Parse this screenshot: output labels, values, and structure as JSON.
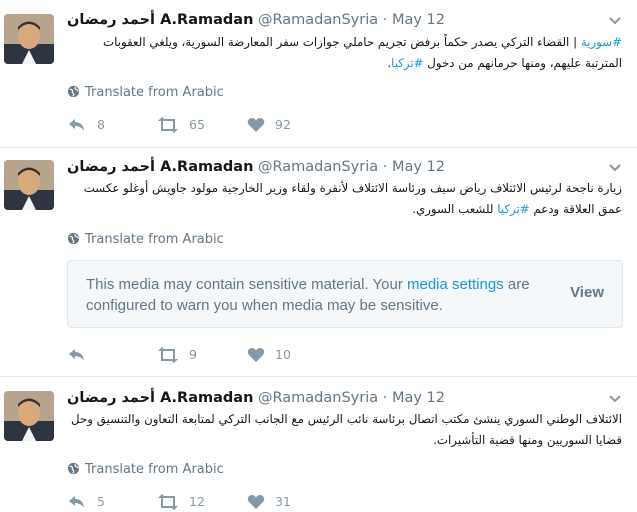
{
  "tweets": [
    {
      "name_ar": "أحمد رمضان",
      "name": "A.Ramadan",
      "handle": "@RamadanSyria",
      "dot": "·",
      "date": "May 12",
      "body_hashtag_a": "#سورية",
      "body_sep": " | ",
      "body_text": "القضاء التركي يصدر حكماً برفض تجريم حاملي جوازات سفر المعارضة السورية، ويلغي العقوبات المترتبة عليهم، ومنها حرمانهم من دخول ",
      "body_hashtag_b": "#تركيا",
      "body_end": ".",
      "translate": "Translate from Arabic",
      "retweets": "65",
      "replies": "8",
      "likes": "92"
    },
    {
      "name_ar": "أحمد رمضان",
      "name": "A.Ramadan",
      "handle": "@RamadanSyria",
      "dot": "·",
      "date": "May 12",
      "body_text": "زيارة ناجحة لرئيس الائتلاف رياض سيف ورئاسة الائتلاف لأنقرة ولقاء وزير الخارجية مولود جاويش أوغلو عكست عمق العلاقة ودعم ",
      "body_hashtag": "#تركيا",
      "body_end": " للشعب السوري.",
      "translate": "Translate from Arabic",
      "media_text_1": "This media may contain sensitive material. Your ",
      "media_link": "media settings",
      "media_text_2": " are configured to warn you when media may be sensitive.",
      "media_view": "View",
      "replies": "",
      "retweets": "9",
      "likes": "10"
    },
    {
      "name_ar": "أحمد رمضان",
      "name": "A.Ramadan",
      "handle": "@RamadanSyria",
      "dot": "·",
      "date": "May 12",
      "body_text": "الائتلاف الوطني السوري ينشئ مكتب اتصال برئاسة نائب الرئيس مع الجانب التركي لمتابعة التعاون والتنسيق وحل قضايا السوريين ومنها قضية التأشيرات.",
      "translate": "Translate from Arabic",
      "replies": "5",
      "retweets": "12",
      "likes": "31"
    }
  ],
  "icons": {
    "avatar": "user-avatar",
    "chevron": "chevron-down-icon",
    "globe": "globe-icon",
    "reply": "reply-icon",
    "retweet": "retweet-icon",
    "like": "heart-icon"
  },
  "colors": {
    "link": "#1b95e0",
    "muted": "#657786",
    "icon": "#8899a6"
  }
}
